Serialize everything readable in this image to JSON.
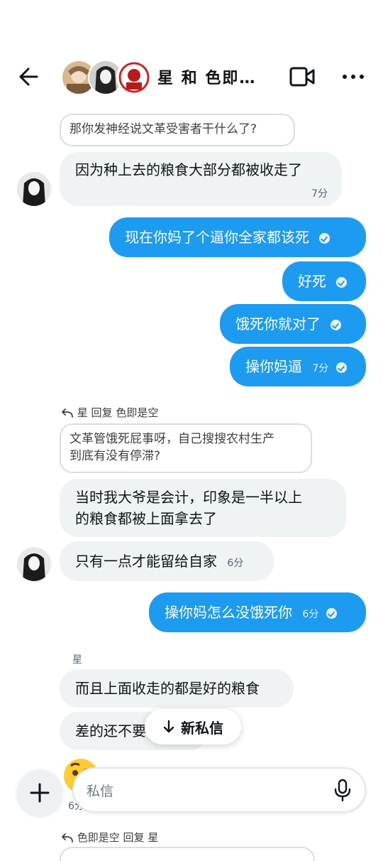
{
  "header": {
    "title": "星 和 色即…",
    "back_icon": "arrow-left-icon",
    "video_icon": "video-camera-icon",
    "more_icon": "more-horizontal-icon"
  },
  "messages": [
    {
      "type": "quote",
      "text": "那你发神经说文革受害者干什么了?"
    },
    {
      "type": "in",
      "text": "因为种上去的粮食大部分都被收走了",
      "time": "7分"
    },
    {
      "type": "out",
      "text": "现在你妈了个逼你全家都该死"
    },
    {
      "type": "out",
      "text": "好死"
    },
    {
      "type": "out",
      "text": "饿死你就对了"
    },
    {
      "type": "out",
      "text": "操你妈逼",
      "time": "7分"
    },
    {
      "type": "reply_header",
      "text": "星 回复 色即是空"
    },
    {
      "type": "quote",
      "line1": "文革管饿死屁事呀，自己搜搜农村生产",
      "line2": "到底有没有停滞?"
    },
    {
      "type": "in",
      "line1": "当时我大爷是会计，印象是一半以上",
      "line2": "的粮食都被上面拿去了"
    },
    {
      "type": "in",
      "text": "只有一点才能留给自家",
      "time": "6分"
    },
    {
      "type": "out",
      "text": "操你妈怎么没饿死你",
      "time": "6分"
    },
    {
      "type": "sender",
      "text": "星"
    },
    {
      "type": "in",
      "text": "而且上面收走的都是好的粮食"
    },
    {
      "type": "in",
      "text": "差的还不要"
    },
    {
      "type": "time_partial",
      "text": "6分"
    },
    {
      "type": "reply_header",
      "text": "色即是空 回复 星"
    }
  ],
  "toast": {
    "label": "新私信"
  },
  "composer": {
    "placeholder": "私信",
    "plus_icon": "plus-icon",
    "mic_icon": "microphone-icon"
  },
  "colors": {
    "accent": "#1d9bf0",
    "incoming": "#eff3f4"
  }
}
